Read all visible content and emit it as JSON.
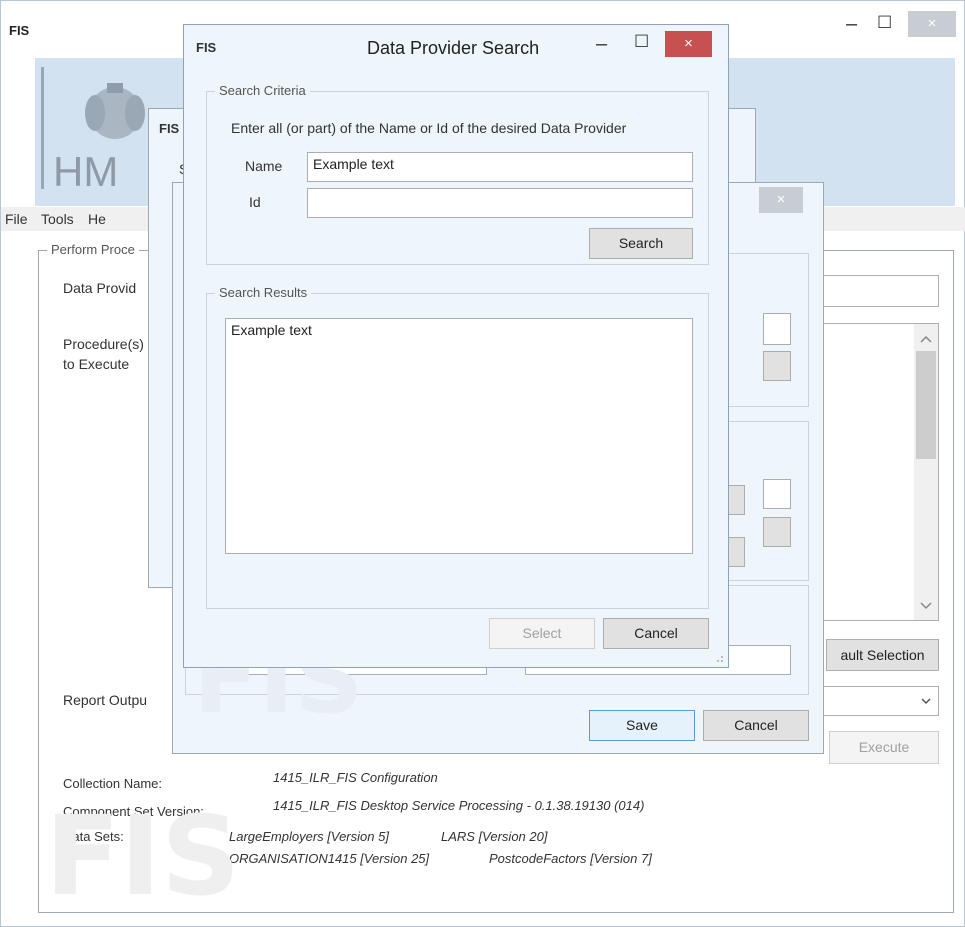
{
  "main_window": {
    "title": "FIS",
    "logo_text": "HM",
    "menu": [
      "File",
      "Tools",
      "He"
    ],
    "group_title": "Perform Proce",
    "labels": {
      "data_provider": "Data Provid",
      "procedures": "Procedure(s)",
      "procedures_2": "to Execute",
      "report_output": "Report Outpu"
    },
    "buttons": {
      "default_selection": "ault Selection",
      "execute": "Execute"
    },
    "info": {
      "collection_label": "Collection Name:",
      "collection_value": "1415_ILR_FIS Configuration",
      "component_label": "Component Set Version:",
      "component_value": "1415_ILR_FIS Desktop Service Processing - 0.1.38.19130 (014)",
      "datasets_label": "Data Sets:",
      "dataset_1": "LargeEmployers [Version 5]",
      "dataset_2": "LARS [Version 20]",
      "dataset_3": "ORGANISATION1415 [Version 25]",
      "dataset_4": "PostcodeFactors [Version 7]"
    },
    "watermark": "FIS"
  },
  "middle_window": {
    "title": "FIS",
    "label_fragment": "S",
    "buttons": {
      "save": "Save",
      "cancel": "Cancel"
    },
    "watermark": "FIS"
  },
  "dialog": {
    "app_title": "FIS",
    "title": "Data Provider Search",
    "search_criteria": {
      "legend": "Search Criteria",
      "instruction": "Enter all (or part) of the Name or Id of the desired Data Provider",
      "name_label": "Name",
      "name_value": "Example text",
      "id_label": "Id",
      "id_value": "",
      "search_button": "Search"
    },
    "search_results": {
      "legend": "Search Results",
      "items": [
        "Example text"
      ]
    },
    "buttons": {
      "select": "Select",
      "cancel": "Cancel"
    },
    "watermark": "FIS"
  },
  "window_controls": {
    "minimize": "–",
    "maximize": "☐",
    "close": "×"
  },
  "icons": {
    "crest": "crest-icon",
    "scroll_up": "chevron-up-icon",
    "scroll_down": "chevron-down-icon",
    "dropdown": "chevron-down-icon",
    "resize_grip": "resize-grip-icon"
  },
  "colors": {
    "close_active": "#c75050",
    "header_band": "#d3e2f0",
    "dialog_body": "#eef5fb",
    "primary_button_border": "#5b9bd5"
  }
}
